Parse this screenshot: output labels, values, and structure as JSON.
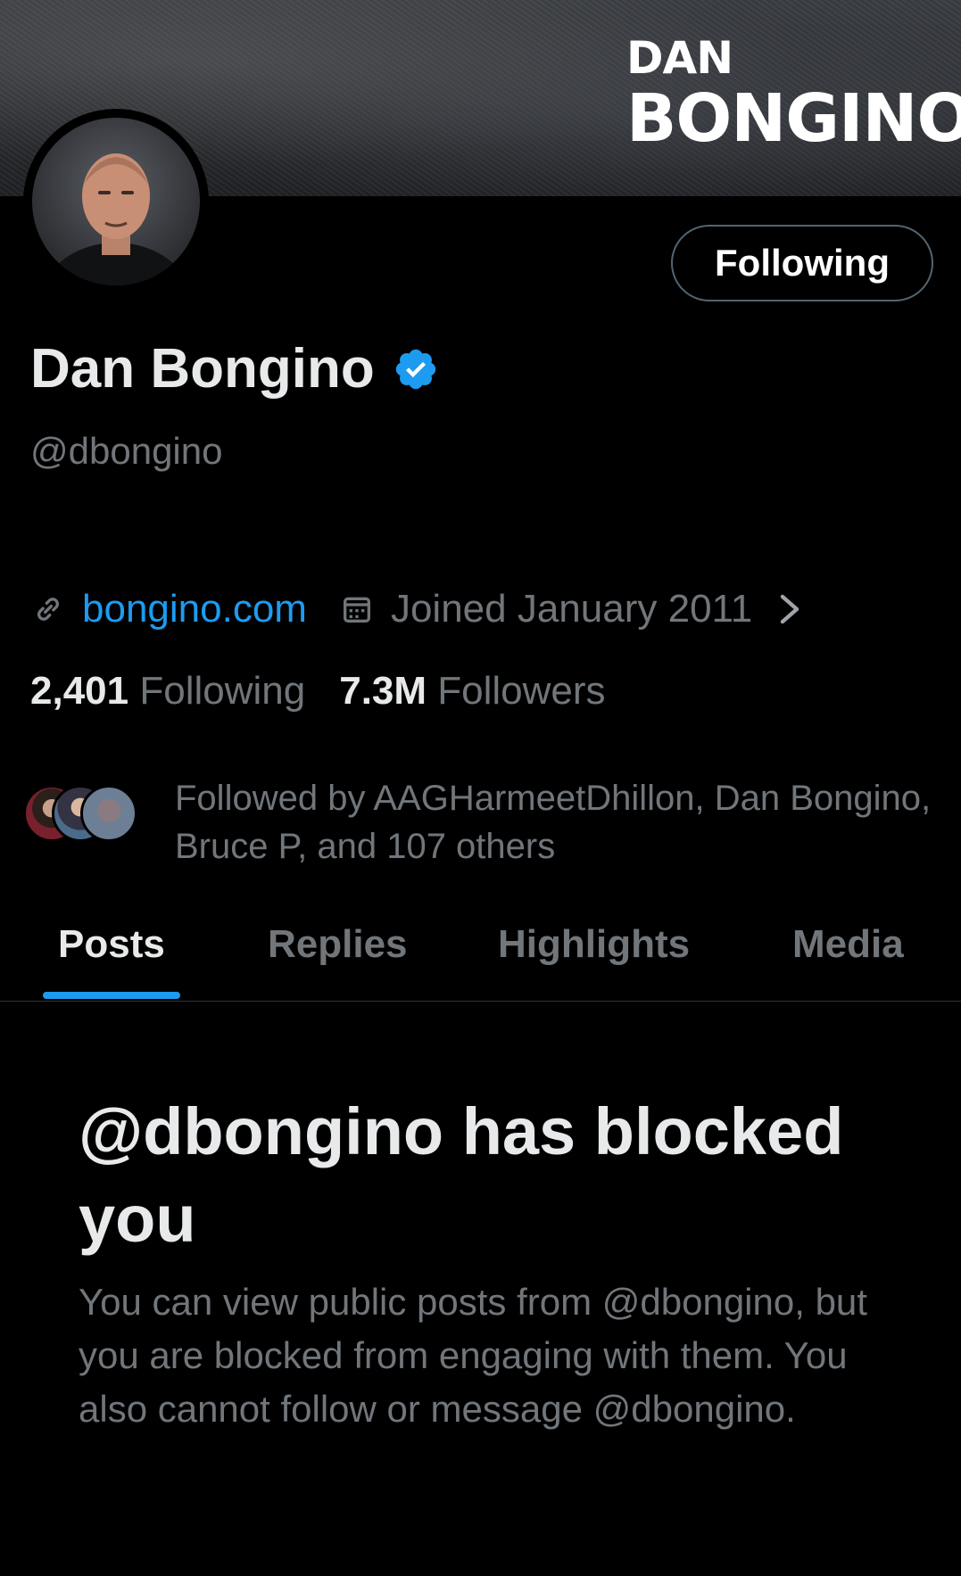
{
  "banner": {
    "logo_line1": "DAN",
    "logo_line2": "BONGINO"
  },
  "profile": {
    "name": "Dan Bongino",
    "handle": "@dbongino",
    "follow_button_label": "Following",
    "verified": true,
    "website": "bongino.com",
    "joined": "Joined January 2011"
  },
  "stats": {
    "following_count": "2,401",
    "following_label": "Following",
    "followers_count": "7.3M",
    "followers_label": "Followers"
  },
  "followed_by": {
    "text": "Followed by AAGHarmeetDhillon, Dan Bongino, Bruce P, and 107 others"
  },
  "tabs": [
    {
      "label": "Posts",
      "active": true
    },
    {
      "label": "Replies",
      "active": false
    },
    {
      "label": "Highlights",
      "active": false
    },
    {
      "label": "Media",
      "active": false
    }
  ],
  "blocked": {
    "title": "@dbongino has blocked you",
    "body": "You can view public posts from @dbongino, but you are blocked from engaging with them. You also cannot follow or message @dbongino."
  },
  "colors": {
    "background": "#000000",
    "accent": "#1d9bf0",
    "primary_text": "#e7e9ea",
    "secondary_text": "#71767b",
    "border": "#2f3336"
  },
  "icons": [
    "link-icon",
    "calendar-icon",
    "chevron-right-icon",
    "verified-badge-icon"
  ]
}
